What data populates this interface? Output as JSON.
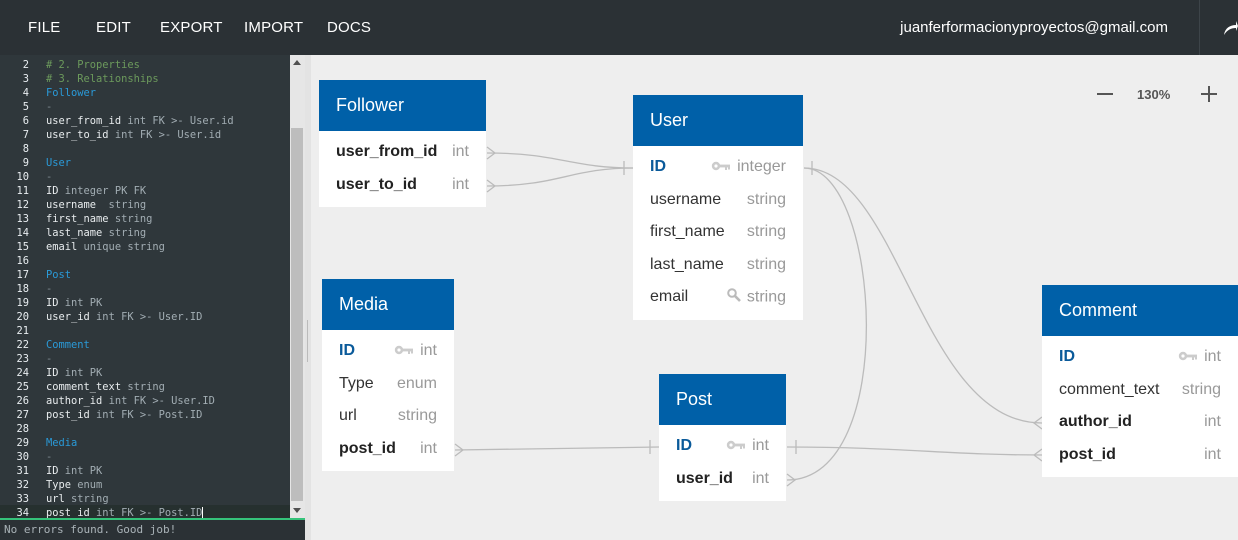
{
  "menu": {
    "file": "FILE",
    "edit": "EDIT",
    "export": "EXPORT",
    "import": "IMPORT",
    "docs": "DOCS"
  },
  "user_email": "juanferformacionyproyectos@gmail.com",
  "editor": {
    "lines": [
      {
        "n": "2",
        "text": "# 2. Properties",
        "kind": "comment"
      },
      {
        "n": "3",
        "text": "# 3. Relationships",
        "kind": "comment"
      },
      {
        "n": "4",
        "text": "Follower",
        "kind": "table"
      },
      {
        "n": "5",
        "text": "-",
        "kind": "sep"
      },
      {
        "n": "6",
        "name": "user_from_id",
        "rest": " int FK >- User.id",
        "kind": "field"
      },
      {
        "n": "7",
        "name": "user_to_id",
        "rest": " int FK >- User.id",
        "kind": "field"
      },
      {
        "n": "8",
        "text": "",
        "kind": "blank"
      },
      {
        "n": "9",
        "text": "User",
        "kind": "table"
      },
      {
        "n": "10",
        "text": "-",
        "kind": "sep"
      },
      {
        "n": "11",
        "name": "ID",
        "rest": " integer PK FK",
        "kind": "field"
      },
      {
        "n": "12",
        "name": "username",
        "rest": "  string",
        "kind": "field"
      },
      {
        "n": "13",
        "name": "first_name",
        "rest": " string",
        "kind": "field"
      },
      {
        "n": "14",
        "name": "last_name",
        "rest": " string",
        "kind": "field"
      },
      {
        "n": "15",
        "name": "email",
        "rest": " unique string",
        "kind": "field"
      },
      {
        "n": "16",
        "text": "",
        "kind": "blank"
      },
      {
        "n": "17",
        "text": "Post",
        "kind": "table"
      },
      {
        "n": "18",
        "text": "-",
        "kind": "sep"
      },
      {
        "n": "19",
        "name": "ID",
        "rest": " int PK",
        "kind": "field"
      },
      {
        "n": "20",
        "name": "user_id",
        "rest": " int FK >- User.ID",
        "kind": "field"
      },
      {
        "n": "21",
        "text": "",
        "kind": "blank"
      },
      {
        "n": "22",
        "text": "Comment",
        "kind": "table"
      },
      {
        "n": "23",
        "text": "-",
        "kind": "sep"
      },
      {
        "n": "24",
        "name": "ID",
        "rest": " int PK",
        "kind": "field"
      },
      {
        "n": "25",
        "name": "comment_text",
        "rest": " string",
        "kind": "field"
      },
      {
        "n": "26",
        "name": "author_id",
        "rest": " int FK >- User.ID",
        "kind": "field"
      },
      {
        "n": "27",
        "name": "post_id",
        "rest": " int FK >- Post.ID",
        "kind": "field"
      },
      {
        "n": "28",
        "text": "",
        "kind": "blank"
      },
      {
        "n": "29",
        "text": "Media",
        "kind": "table"
      },
      {
        "n": "30",
        "text": "-",
        "kind": "sep"
      },
      {
        "n": "31",
        "name": "ID",
        "rest": " int PK",
        "kind": "field"
      },
      {
        "n": "32",
        "name": "Type",
        "rest": " enum",
        "kind": "field"
      },
      {
        "n": "33",
        "name": "url",
        "rest": " string",
        "kind": "field"
      },
      {
        "n": "34",
        "name": "post_id",
        "rest": " int FK >- Post.ID",
        "kind": "field",
        "cursor": true
      }
    ]
  },
  "status": "No errors found. Good job!",
  "zoom": "130%",
  "tables": [
    {
      "id": "follower",
      "title": "Follower",
      "fields": [
        {
          "name": "user_from_id",
          "type": "int",
          "style": "bold"
        },
        {
          "name": "user_to_id",
          "type": "int",
          "style": "bold"
        }
      ]
    },
    {
      "id": "user",
      "title": "User",
      "fields": [
        {
          "name": "ID",
          "type": "integer",
          "style": "pk",
          "icon": "key-icon"
        },
        {
          "name": "username",
          "type": "string",
          "style": "normal"
        },
        {
          "name": "first_name",
          "type": "string",
          "style": "normal"
        },
        {
          "name": "last_name",
          "type": "string",
          "style": "normal"
        },
        {
          "name": "email",
          "type": "string",
          "style": "normal",
          "icon": "search-icon"
        }
      ]
    },
    {
      "id": "media",
      "title": "Media",
      "fields": [
        {
          "name": "ID",
          "type": "int",
          "style": "pk",
          "icon": "key-icon"
        },
        {
          "name": "Type",
          "type": "enum",
          "style": "normal"
        },
        {
          "name": "url",
          "type": "string",
          "style": "normal"
        },
        {
          "name": "post_id",
          "type": "int",
          "style": "bold"
        }
      ]
    },
    {
      "id": "post",
      "title": "Post",
      "fields": [
        {
          "name": "ID",
          "type": "int",
          "style": "pk",
          "icon": "key-icon"
        },
        {
          "name": "user_id",
          "type": "int",
          "style": "bold"
        }
      ]
    },
    {
      "id": "comment",
      "title": "Comment",
      "fields": [
        {
          "name": "ID",
          "type": "int",
          "style": "pk",
          "icon": "key-icon"
        },
        {
          "name": "comment_text",
          "type": "string",
          "style": "normal"
        },
        {
          "name": "author_id",
          "type": "int",
          "style": "bold"
        },
        {
          "name": "post_id",
          "type": "int",
          "style": "bold"
        }
      ]
    }
  ],
  "colors": {
    "header": "#0060a8",
    "topbar": "#2b3135",
    "editor_bg": "#2f373b",
    "connector": "#bbbbbb"
  }
}
